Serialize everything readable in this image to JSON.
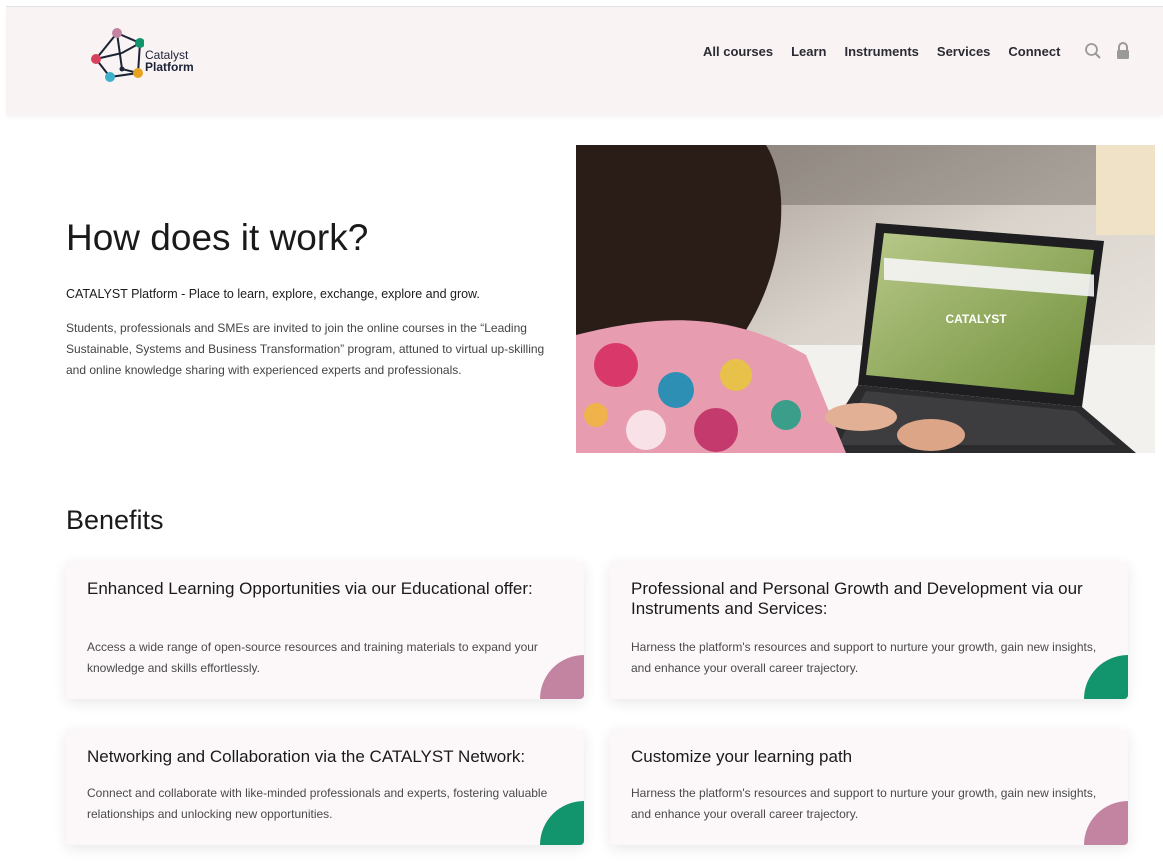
{
  "header": {
    "logo_line1": "Catalyst",
    "logo_line2": "Platform",
    "nav": [
      "All courses",
      "Learn",
      "Instruments",
      "Services",
      "Connect"
    ],
    "icons": [
      "search-icon",
      "lock-icon"
    ]
  },
  "hero": {
    "title": "How does it work?",
    "subtitle": "CATALYST Platform - Place to learn, explore, exchange, explore and grow.",
    "body": "Students, professionals and SMEs are invited to join the online courses in the “Leading Sustainable, Systems and Business Transformation” program, attuned to virtual up-skilling and online knowledge sharing with experienced experts and professionals.",
    "laptop_screen_text": "CATALYST"
  },
  "benefits": {
    "title": "Benefits",
    "cards": [
      {
        "title": "Enhanced Learning Opportunities via our Educational offer:",
        "text": "Access a wide range of open-source resources and training materials to expand your knowledge and skills effortlessly.",
        "accent": "#c384a2"
      },
      {
        "title": "Professional and Personal Growth and Development via our Instruments and Services:",
        "text": "Harness the platform's resources and support to nurture your growth, gain new insights, and enhance your overall career trajectory.",
        "accent": "#12946c"
      },
      {
        "title": "Networking and Collaboration via the CATALYST Network:",
        "text": "Connect and collaborate with like-minded professionals and experts, fostering valuable relationships and unlocking new opportunities.",
        "accent": "#12946c"
      },
      {
        "title": "Customize your learning path",
        "text": "Harness the platform's resources and support to nurture your growth, gain new insights, and enhance your overall career trajectory.",
        "accent": "#c384a2"
      }
    ]
  }
}
